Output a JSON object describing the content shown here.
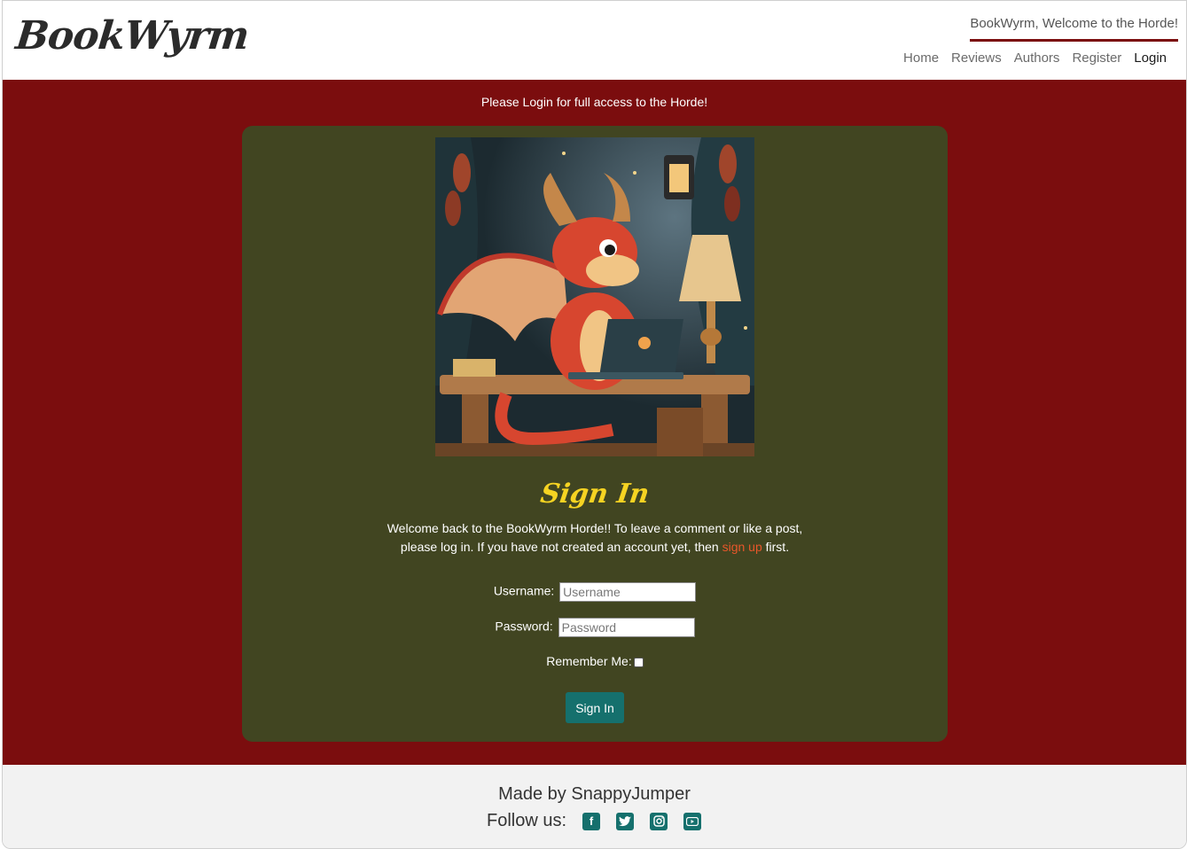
{
  "header": {
    "logo": "BookWyrm",
    "welcome": "BookWyrm, Welcome to the Horde!",
    "nav": [
      {
        "label": "Home"
      },
      {
        "label": "Reviews"
      },
      {
        "label": "Authors"
      },
      {
        "label": "Register"
      },
      {
        "label": "Login"
      }
    ]
  },
  "main": {
    "notice": "Please Login for full access to the Horde!",
    "title": "Sign In",
    "intro_line1": "Welcome back to the BookWyrm Horde!! To leave a comment or like a post,",
    "intro_line2_pre": "please log in. If you have not created an account yet, then ",
    "intro_link": "sign up",
    "intro_line2_post": " first.",
    "form": {
      "username_label": "Username:",
      "username_placeholder": "Username",
      "password_label": "Password:",
      "password_placeholder": "Password",
      "remember_label": "Remember Me:",
      "submit_label": "Sign In"
    },
    "hero_image": "dragon-at-laptop-illustration"
  },
  "footer": {
    "made_by": "Made by SnappyJumper",
    "follow": "Follow us:",
    "social": [
      "facebook-icon",
      "twitter-icon",
      "instagram-icon",
      "youtube-icon"
    ]
  },
  "colors": {
    "primary_red": "#7b0d0e",
    "card_olive": "#414521",
    "title_yellow": "#f6d322",
    "link_orange": "#e8572a",
    "button_teal": "#15706d"
  }
}
